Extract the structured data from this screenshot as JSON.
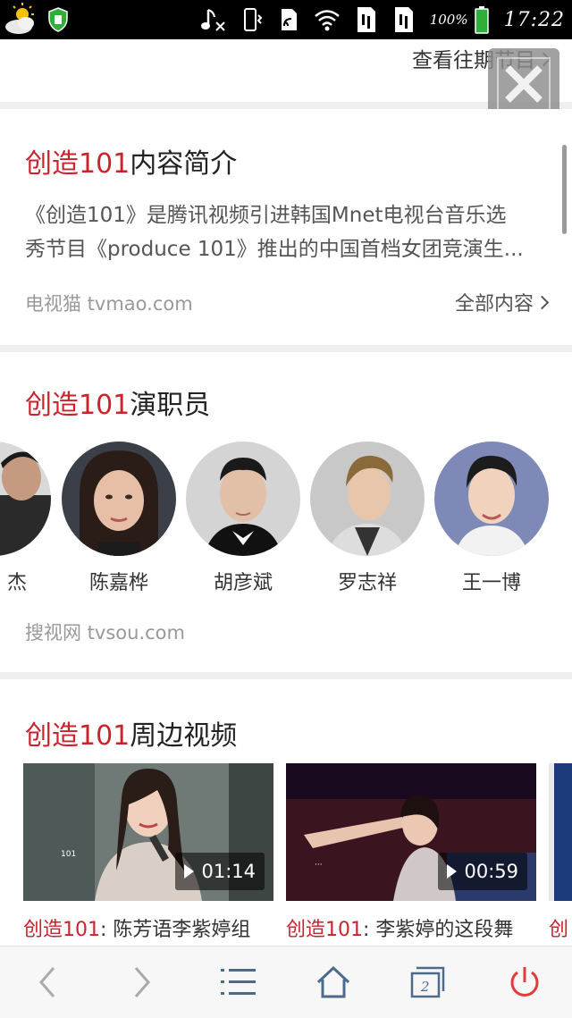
{
  "status_bar": {
    "battery_text": "100%",
    "time": "17:22",
    "icons": [
      "weather-icon",
      "shield-icon",
      "music-off-icon",
      "vibrate-icon",
      "nfc-icon",
      "wifi-icon",
      "sim1-icon",
      "sim2-icon",
      "battery-icon"
    ]
  },
  "top_card": {
    "history_link": "查看往期节目"
  },
  "intro": {
    "title_highlight": "创造101",
    "title_rest": "内容简介",
    "line1": "《创造101》是腾讯视频引进韩国Mnet电视台音乐选",
    "line2": "秀节目《produce 101》推出的中国首档女团竞演生...",
    "source": "电视猫 tvmao.com",
    "more_link": "全部内容"
  },
  "cast": {
    "title_highlight": "创造101",
    "title_rest": "演职员",
    "members": [
      {
        "name": "杰"
      },
      {
        "name": "陈嘉桦"
      },
      {
        "name": "胡彦斌"
      },
      {
        "name": "罗志祥"
      },
      {
        "name": "王一博"
      }
    ],
    "source": "搜视网 tvsou.com"
  },
  "videos": {
    "title_highlight": "创造101",
    "title_rest": "周边视频",
    "items": [
      {
        "duration": "01:14",
        "caption_highlight": "创造101",
        "caption_rest": ": 陈芳语李紫婷组"
      },
      {
        "duration": "00:59",
        "caption_highlight": "创造101",
        "caption_rest": ": 李紫婷的这段舞"
      },
      {
        "duration": "",
        "caption_highlight": "创",
        "caption_rest": ""
      }
    ]
  },
  "colors": {
    "accent_red": "#c9232e",
    "power_red": "#e33b3b"
  },
  "toolbar": {
    "icons": [
      "back-icon",
      "forward-icon",
      "menu-icon",
      "home-icon",
      "tabs-icon",
      "power-icon"
    ],
    "tab_count": "2"
  }
}
